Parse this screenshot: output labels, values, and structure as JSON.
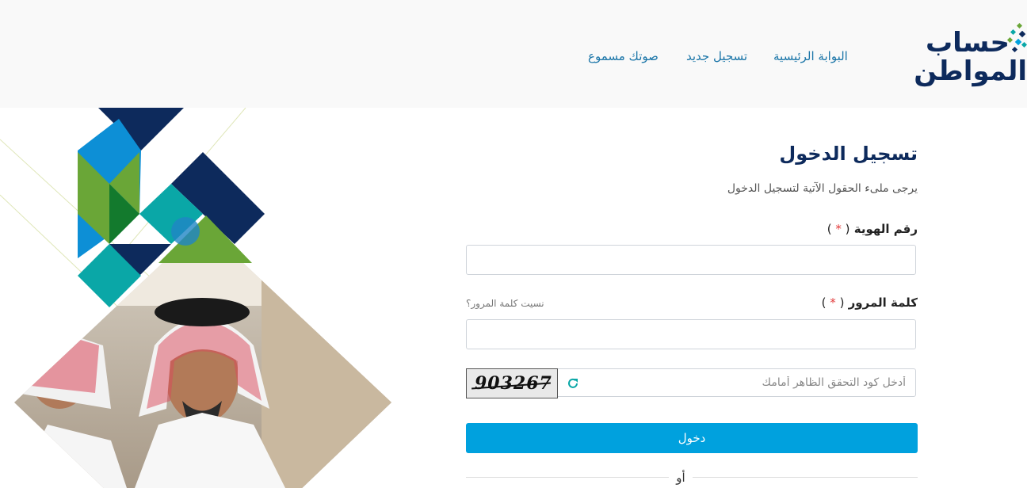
{
  "header": {
    "logo": {
      "line1": "حساب",
      "line2": "المواطن"
    },
    "nav": [
      {
        "label": "البوابة الرئيسية"
      },
      {
        "label": "تسجيل جديد"
      },
      {
        "label": "صوتك مسموع"
      }
    ]
  },
  "form": {
    "title": "تسجيل الدخول",
    "subtitle": "يرجى ملىء الحقول الآتية لتسجيل الدخول",
    "id_label": "رقم الهوية",
    "password_label": "كلمة المرور",
    "required_mark": "*",
    "forgot_password": "نسيت كلمة المرور؟",
    "captcha_code": "903267",
    "captcha_placeholder": "أدخل كود التحقق الظاهر أمامك",
    "login_button": "دخول",
    "or": "أو"
  },
  "colors": {
    "navy": "#0d2a5c",
    "brand_blue": "#00a1de",
    "nav_link": "#1a75a8",
    "green": "#6aa637",
    "teal": "#0aa7a7",
    "required": "#e23b3b"
  },
  "icons": {
    "refresh": "refresh-icon"
  }
}
